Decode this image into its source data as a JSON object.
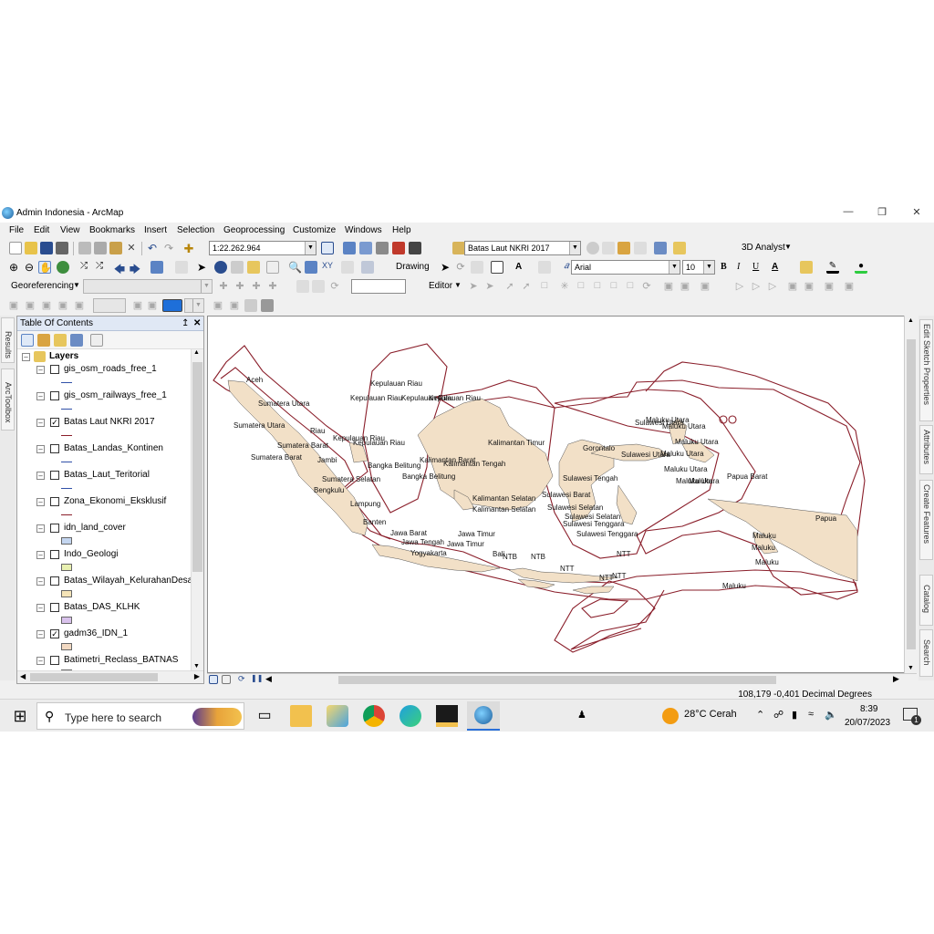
{
  "window": {
    "title": "Admin Indonesia - ArcMap"
  },
  "menu": [
    "File",
    "Edit",
    "View",
    "Bookmarks",
    "Insert",
    "Selection",
    "Geoprocessing",
    "Customize",
    "Windows",
    "Help"
  ],
  "toolbar": {
    "scale": "1:22.262.964",
    "target_layer": "Batas Laut NKRI 2017",
    "analyst": "3D Analyst",
    "drawing": "Drawing",
    "font": "Arial",
    "font_size": "10",
    "georeferencing": "Georeferencing",
    "editor": "Editor",
    "bold": "B",
    "italic": "I",
    "underline": "U",
    "letter_a": "A"
  },
  "side_tabs_left": [
    "Results",
    "ArcToolbox"
  ],
  "side_tabs_right": [
    "Edit Sketch Properties",
    "Attributes",
    "Create Features",
    "Catalog",
    "Search"
  ],
  "toc": {
    "title": "Table Of Contents",
    "pin": "↥",
    "close": "✕",
    "root": "Layers",
    "layers": [
      {
        "name": "gis_osm_roads_free_1",
        "checked": false,
        "symbol": "line",
        "color": "#3050a8"
      },
      {
        "name": "gis_osm_railways_free_1",
        "checked": false,
        "symbol": "line",
        "color": "#3050a8"
      },
      {
        "name": "Batas Laut NKRI 2017",
        "checked": true,
        "symbol": "line",
        "color": "#8a1e2a"
      },
      {
        "name": "Batas_Landas_Kontinen",
        "checked": false,
        "symbol": "line",
        "color": "#3050a8"
      },
      {
        "name": "Batas_Laut_Teritorial",
        "checked": false,
        "symbol": "line",
        "color": "#3050a8"
      },
      {
        "name": "Zona_Ekonomi_Eksklusif",
        "checked": false,
        "symbol": "line",
        "color": "#8a1e2a"
      },
      {
        "name": "idn_land_cover",
        "checked": false,
        "symbol": "box",
        "color": "#c4d6f0"
      },
      {
        "name": "Indo_Geologi",
        "checked": false,
        "symbol": "box",
        "color": "#e8f0b0"
      },
      {
        "name": "Batas_Wilayah_KelurahanDesa_10",
        "checked": false,
        "symbol": "box",
        "color": "#f5e4b8"
      },
      {
        "name": "Batas_DAS_KLHK",
        "checked": false,
        "symbol": "box",
        "color": "#d9c2ec"
      },
      {
        "name": "gadm36_IDN_1",
        "checked": true,
        "symbol": "box",
        "color": "#f2d9c2"
      },
      {
        "name": "Batimetri_Reclass_BATNAS",
        "checked": false,
        "symbol": "box",
        "color": "#c4d6f0"
      }
    ]
  },
  "map": {
    "land_color": "#f2e0c7",
    "boundary_color": "#8a1e2a",
    "labels": [
      "Aceh",
      "Sumatera Utara",
      "Sumatera Utara",
      "Riau",
      "Kepulauan Riau",
      "Kepulauan Riau",
      "Kepulauan Riau",
      "Kepulauan Riau",
      "Kepulauan Riau",
      "Kepulauan Riau",
      "Sumatera Barat",
      "Sumatera Barat",
      "Jambi",
      "Sumatera Selatan",
      "Bengkulu",
      "Bangka Belitung",
      "Bangka Belitung",
      "Lampung",
      "Banten",
      "Jawa Barat",
      "Jawa Tengah",
      "Yogyakarta",
      "Jawa Timur",
      "Jawa Timur",
      "Bali",
      "NTB",
      "NTB",
      "NTT",
      "NTT",
      "NTT",
      "NTT",
      "Kalimantan Barat",
      "Kalimantan Tengah",
      "Kalimantan Timur",
      "Kalimantan Selatan",
      "Kalimantan Selatan",
      "Gorontalo",
      "Sulawesi Utara",
      "Sulawesi Utara",
      "Sulawesi Tengah",
      "Sulawesi Barat",
      "Sulawesi Selatan",
      "Sulawesi Selatan",
      "Sulawesi Tenggara",
      "Sulawesi Tenggara",
      "Maluku Utara",
      "Maluku Utara",
      "Maluku Utara",
      "Maluku Utara",
      "Maluku Utara",
      "Maluku Utara",
      "Maluku",
      "Maluku",
      "Maluku",
      "Maluku",
      "Maluku",
      "Papua Barat",
      "Papua"
    ]
  },
  "status": {
    "coords": "108,179  -0,401 Decimal Degrees"
  },
  "taskbar": {
    "search_placeholder": "Type here to search",
    "weather": "28°C  Cerah",
    "time": "8:39",
    "date": "20/07/2023",
    "notifications": "1"
  }
}
